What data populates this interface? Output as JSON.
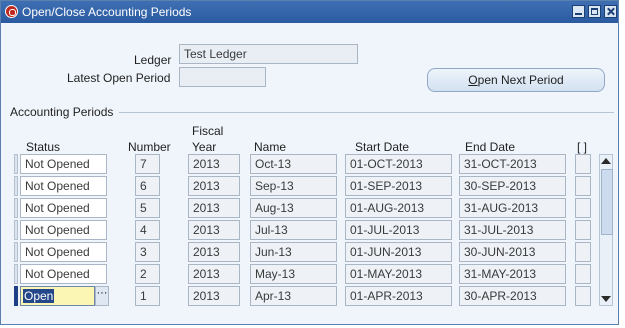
{
  "window": {
    "title": "Open/Close Accounting Periods",
    "titlebar_color": "#2f62a8"
  },
  "form": {
    "ledger_label": "Ledger",
    "ledger_value": "Test Ledger",
    "latest_open_period_label": "Latest Open Period",
    "latest_open_period_value": "",
    "open_next_button": {
      "prefix": "",
      "underlined": "O",
      "rest": "pen Next Period"
    }
  },
  "periods": {
    "group_title": "Accounting Periods",
    "headers": {
      "status": "Status",
      "number": "Number",
      "fiscal_year_line1": "Fiscal",
      "fiscal_year_line2": "Year",
      "name": "Name",
      "start_date": "Start Date",
      "end_date": "End Date",
      "checkbox": "[ ]"
    },
    "rows": [
      {
        "status": "Not Opened",
        "number": "7",
        "year": "2013",
        "name": "Oct-13",
        "start": "01-OCT-2013",
        "end": "31-OCT-2013"
      },
      {
        "status": "Not Opened",
        "number": "6",
        "year": "2013",
        "name": "Sep-13",
        "start": "01-SEP-2013",
        "end": "30-SEP-2013"
      },
      {
        "status": "Not Opened",
        "number": "5",
        "year": "2013",
        "name": "Aug-13",
        "start": "01-AUG-2013",
        "end": "31-AUG-2013"
      },
      {
        "status": "Not Opened",
        "number": "4",
        "year": "2013",
        "name": "Jul-13",
        "start": "01-JUL-2013",
        "end": "31-JUL-2013"
      },
      {
        "status": "Not Opened",
        "number": "3",
        "year": "2013",
        "name": "Jun-13",
        "start": "01-JUN-2013",
        "end": "30-JUN-2013"
      },
      {
        "status": "Not Opened",
        "number": "2",
        "year": "2013",
        "name": "May-13",
        "start": "01-MAY-2013",
        "end": "31-MAY-2013"
      },
      {
        "status": "Open",
        "number": "1",
        "year": "2013",
        "name": "Apr-13",
        "start": "01-APR-2013",
        "end": "30-APR-2013"
      }
    ],
    "active_row_ellipsis": "···"
  }
}
